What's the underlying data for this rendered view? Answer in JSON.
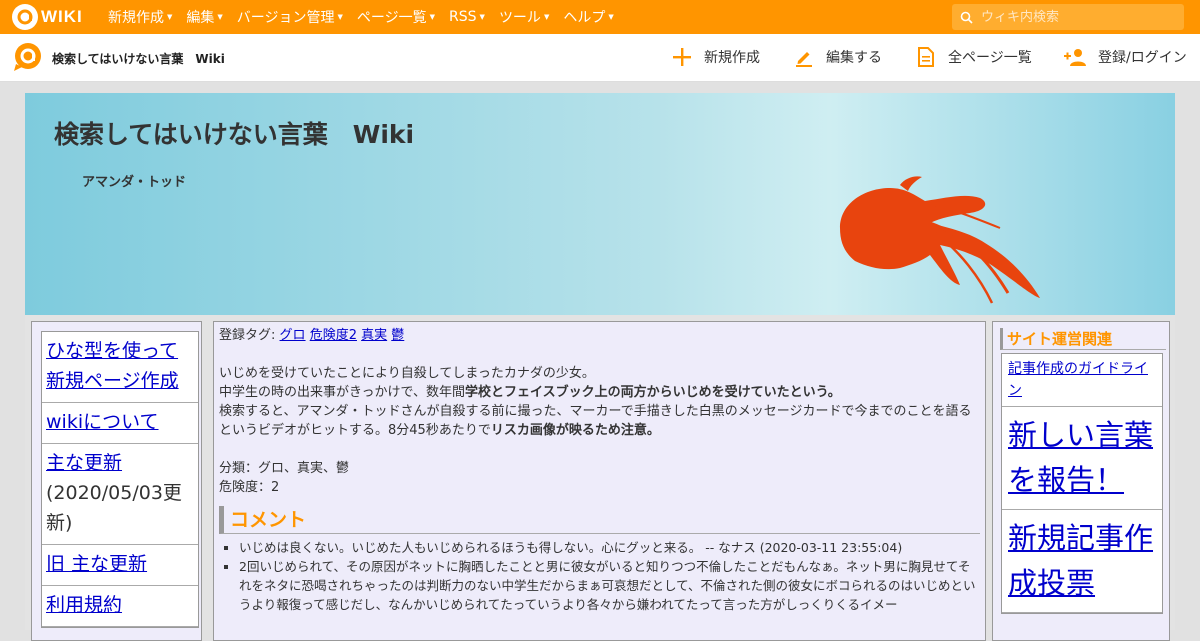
{
  "topbar": {
    "logo_text": "WIKI",
    "menu": [
      "新規作成",
      "編集",
      "バージョン管理",
      "ページ一覧",
      "RSS",
      "ツール",
      "ヘルプ"
    ],
    "search_placeholder": "ウィキ内検索",
    "accent": "#ff9500"
  },
  "subbar": {
    "title": "検索してはいけない言葉　Wiki",
    "actions": {
      "new": "新規作成",
      "edit": "編集する",
      "all_pages": "全ページ一覧",
      "login": "登録/ログイン"
    }
  },
  "banner": {
    "title": "検索してはいけない言葉　Wiki",
    "page_title": "アマンダ・トッド"
  },
  "sidebar": {
    "items": [
      {
        "label": "ひな型を使って新規ページ作成"
      },
      {
        "label": "wikiについて"
      },
      {
        "label": "主な更新",
        "note": "(2020/05/03更新)"
      },
      {
        "label": "旧 主な更新"
      },
      {
        "label": "利用規約"
      }
    ]
  },
  "main": {
    "tags_label": "登録タグ:",
    "tags": [
      "グロ",
      "危険度2",
      "真実",
      "鬱"
    ],
    "p1": "いじめを受けていたことにより自殺してしまったカナダの少女。",
    "p2a": "中学生の時の出来事がきっかけで、数年間",
    "p2b": "学校とフェイスブック上の両方からいじめを受けていたという。",
    "p3a": "検索すると、アマンダ・トッドさんが自殺する前に撮った、マーカーで手描きした白黒のメッセージカードで今までのことを語るというビデオがヒットする。8分45秒あたりで",
    "p3b": "リスカ画像が映るため注意。",
    "category": "分類：グロ、真実、鬱",
    "danger": "危険度：2",
    "comment_heading": "コメント",
    "comments": [
      "いじめは良くない。いじめた人もいじめられるほうも得しない。心にグッと来る。 -- なナス (2020-03-11 23:55:04)",
      "2回いじめられて、その原因がネットに胸晒したことと男に彼女がいると知りつつ不倫したことだもんなぁ。ネット男に胸見せてそれをネタに恐喝されちゃったのは判断力のない中学生だからまぁ可哀想だとして、不倫された側の彼女にボコられるのはいじめというより報復って感じだし、なんかいじめられてたっていうより各々から嫌われてたって言った方がしっくりくるイメー"
    ]
  },
  "rightbar": {
    "title": "サイト運営関連",
    "items": [
      {
        "label": "記事作成のガイドライン"
      },
      {
        "label": "新しい言葉を報告！"
      },
      {
        "label": "新規記事作成投票"
      }
    ]
  }
}
